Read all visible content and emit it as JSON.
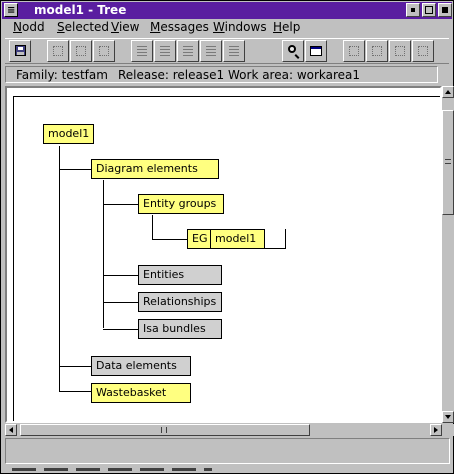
{
  "window": {
    "title": "model1 - Tree",
    "menu_glyph": "≡"
  },
  "menubar": {
    "items": [
      {
        "label_u": "N",
        "label_rest": "odd"
      },
      {
        "label_u": "S",
        "label_rest": "elected"
      },
      {
        "label_u": "V",
        "label_rest": "iew"
      },
      {
        "label_u": "M",
        "label_rest": "essages"
      },
      {
        "label_u": "W",
        "label_rest": "indows"
      },
      {
        "label_u": "H",
        "label_rest": "elp"
      }
    ]
  },
  "infobar": {
    "family": "Family: testfam",
    "release": "Release: release1",
    "work_area": "Work area: workarea1"
  },
  "tree": {
    "root": "model1",
    "diagram_elements": "Diagram elements",
    "entity_groups": "Entity groups",
    "eg_prefix": "EG",
    "eg_name": "model1",
    "entities": "Entities",
    "relationships": "Relationships",
    "isa_bundles": "Isa bundles",
    "data_elements": "Data elements",
    "wastebasket": "Wastebasket"
  },
  "hscroll": {
    "thumb_grip": "III"
  },
  "colors": {
    "title_bar": "#5a1ea0",
    "node_yellow": "#ffff80",
    "node_gray": "#d0d0d0"
  }
}
